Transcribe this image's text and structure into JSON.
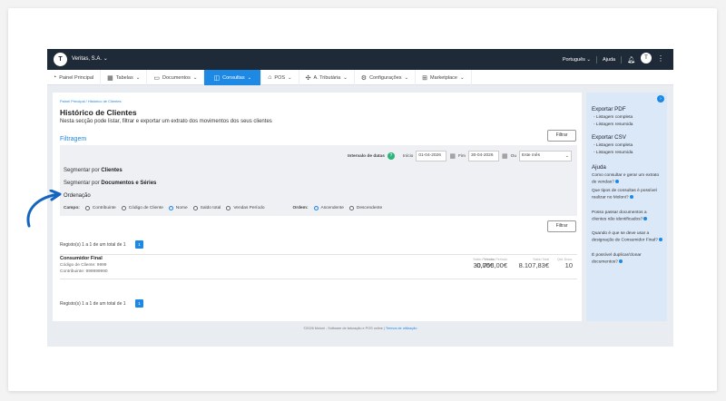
{
  "topbar": {
    "company": "Veritas, S.A.",
    "language": "Português",
    "help": "Ajuda",
    "logo_text": "T"
  },
  "nav": [
    {
      "label": "Painel Principal",
      "icon": "dashboard-icon",
      "glyph": "◔"
    },
    {
      "label": "Tabelas",
      "icon": "grid-icon",
      "glyph": "▦"
    },
    {
      "label": "Documentos",
      "icon": "document-icon",
      "glyph": "▭"
    },
    {
      "label": "Consultas",
      "icon": "none",
      "glyph": ""
    },
    {
      "label": "POS",
      "icon": "pos-icon",
      "glyph": "⌂"
    },
    {
      "label": "A. Tributária",
      "icon": "tax-icon",
      "glyph": "✣"
    },
    {
      "label": "Configurações",
      "icon": "gear-icon",
      "glyph": "⚙"
    },
    {
      "label": "Marketplace",
      "icon": "marketplace-icon",
      "glyph": "⊞"
    }
  ],
  "page": {
    "breadcrumb": "Painel Principal  /  Histórico de Clientes",
    "title": "Histórico de Clientes",
    "subtitle": "Nesta secção pode listar, filtrar e exportar um extrato dos movimentos dos seus clientes",
    "filter_button": "Filtrar",
    "filtragem": "Filtragem"
  },
  "filters": {
    "interval_label": "Intervalo de datas",
    "start_label": "Início",
    "start_value": "01-04-2026",
    "end_label": "Fim",
    "end_value": "30-04-2026",
    "or_label": "Ou",
    "period_select": "Este mês",
    "segment_clients_prefix": "Segmentar por",
    "segment_clients": "Clientes",
    "segment_docs_prefix": "Segmentar por",
    "segment_docs": "Documentos e Séries",
    "ordering": "Ordenação",
    "campo_label": "Campo:",
    "campo_options": [
      "Contribuinte",
      "Código de Cliente",
      "Nome",
      "Saldo total",
      "Vendas Período"
    ],
    "campo_selected": "Nome",
    "ordem_label": "Ordem:",
    "ordem_options": [
      "Ascendente",
      "Descendente"
    ],
    "ordem_selected": "Ascendente"
  },
  "results": {
    "summary_top": "Registo(s) 1 a 1 de um total de 1",
    "summary_bottom": "Registo(s) 1 a 1 de um total de 1",
    "page": "1",
    "rows": [
      {
        "name": "Consumidor Final",
        "code": "Código de Cliente: 9999",
        "nif": "Contribuinte: 999999990",
        "sales_label": "Vendas Período",
        "sales": "30.750,00€",
        "period_balance_label": "Saldo Período",
        "period_balance": "0,00€",
        "total_balance_label": "Saldo Total",
        "total_balance": "8.107,83€",
        "qty_label": "Qtd. Docs.",
        "qty": "10"
      }
    ]
  },
  "footer": {
    "text": "©2026 Moloni - Software de faturação e POS online",
    "link": "Termos de utilização"
  },
  "sidebar": {
    "pdf_title": "Exportar PDF",
    "pdf_items": [
      "- Listagem completa",
      "- Listagem resumida"
    ],
    "csv_title": "Exportar CSV",
    "csv_items": [
      "- Listagem completa",
      "- Listagem resumida"
    ],
    "help_title": "Ajuda",
    "questions": [
      "Como consultar e gerar um extrato de vendas?",
      "Que tipos de consultas é possível realizar no Moloni?",
      "Posso passar documentos a clientes não identificados?",
      "Quando é que se deve usar a designação de Consumidor Final?",
      "É possível duplicar/clonar documentos?"
    ]
  },
  "colors": {
    "accent": "#1e88e5",
    "topbar": "#1f2a38",
    "sidebar": "#dbe8f7",
    "arrow": "#1565c0"
  }
}
